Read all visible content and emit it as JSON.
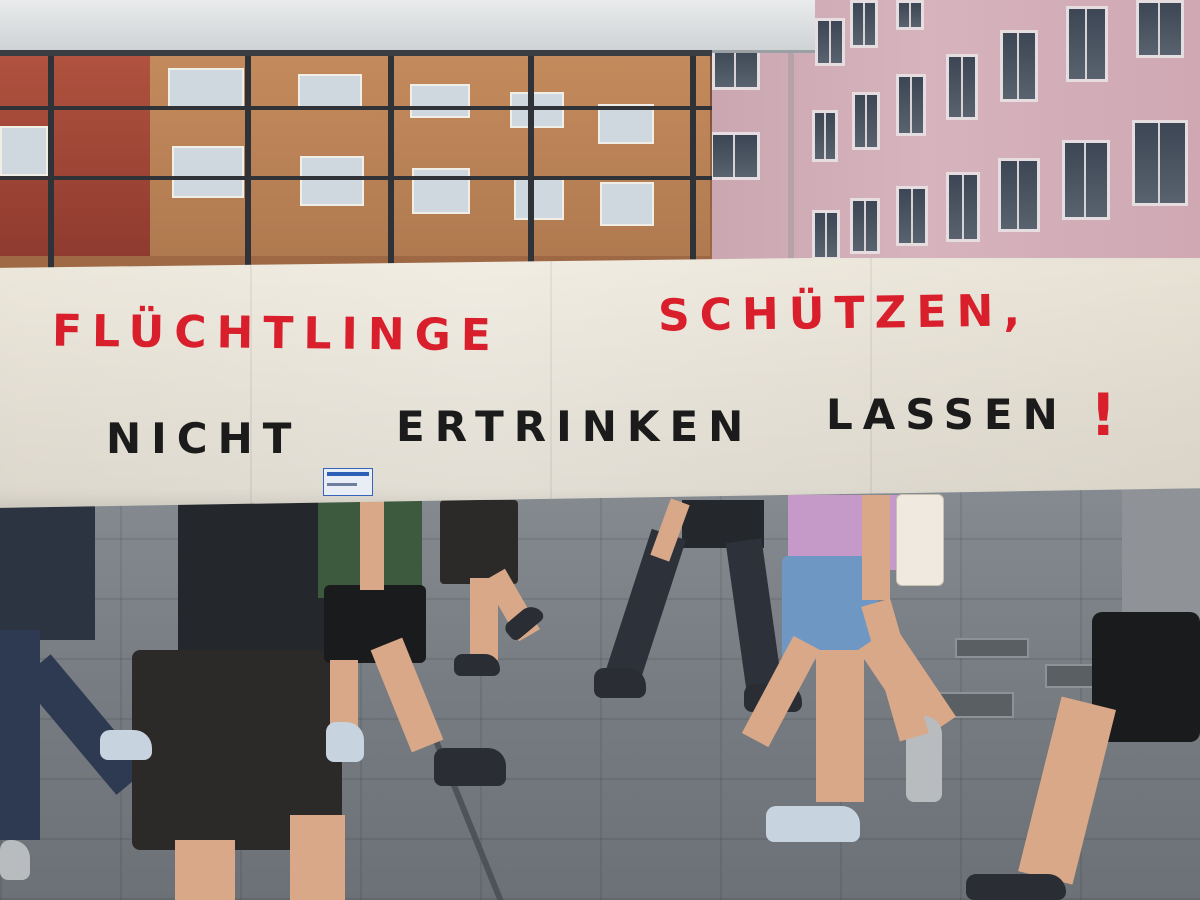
{
  "banner": {
    "line1_left": "FLÜCHTLINGE",
    "line1_right": "SCHÜTZEN,",
    "line2_words": [
      "NICHT",
      "ERTRINKEN",
      "LASSEN"
    ],
    "line2_mark": "!",
    "colors": {
      "cloth": "#efeadf",
      "red_text": "#d81f2b",
      "black_text": "#1b1b1b"
    }
  },
  "reflection_signs": [
    "1.10",
    "1.10",
    "1.10",
    "1.10",
    "1.10"
  ]
}
